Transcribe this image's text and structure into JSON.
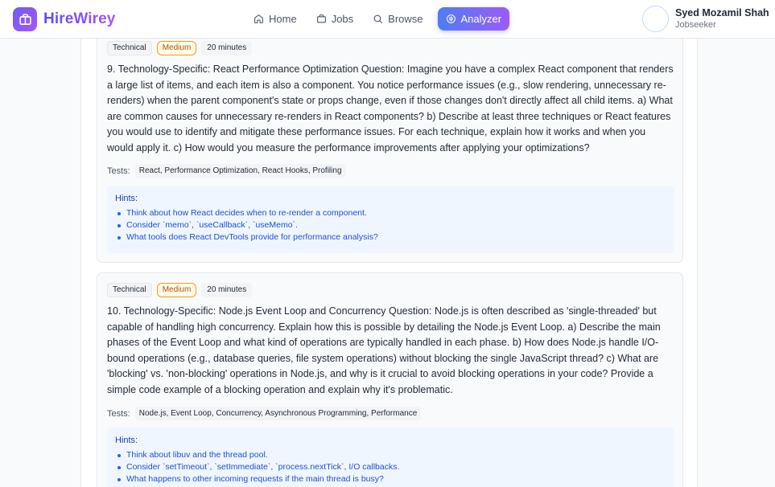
{
  "brand": {
    "name": "HireWirey"
  },
  "nav": {
    "items": [
      {
        "label": "Home",
        "icon": "home-icon"
      },
      {
        "label": "Jobs",
        "icon": "briefcase-icon"
      },
      {
        "label": "Browse",
        "icon": "search-icon"
      },
      {
        "label": "Analyzer",
        "icon": "analyzer-icon"
      }
    ],
    "active": "Analyzer"
  },
  "user": {
    "name": "Syed Mozamil Shah",
    "role": "Jobseeker"
  },
  "questions": [
    {
      "category": "Technical",
      "difficulty": "Medium",
      "duration": "20 minutes",
      "text": "9. Technology-Specific: React Performance Optimization Question: Imagine you have a complex React component that renders a large list of items, and each item is also a component. You notice performance issues (e.g., slow rendering, unnecessary re-renders) when the parent component's state or props change, even if those changes don't directly affect all child items. a) What are common causes for unnecessary re-renders in React components? b) Describe at least three techniques or React features you would use to identify and mitigate these performance issues. For each technique, explain how it works and when you would apply it. c) How would you measure the performance improvements after applying your optimizations?",
      "tests_label": "Tests:",
      "tests": "React, Performance Optimization, React Hooks, Profiling",
      "hints_title": "Hints:",
      "hints": [
        "Think about how React decides when to re-render a component.",
        "Consider `memo`, `useCallback`, `useMemo`.",
        "What tools does React DevTools provide for performance analysis?"
      ]
    },
    {
      "category": "Technical",
      "difficulty": "Medium",
      "duration": "20 minutes",
      "text": "10. Technology-Specific: Node.js Event Loop and Concurrency Question: Node.js is often described as 'single-threaded' but capable of handling high concurrency. Explain how this is possible by detailing the Node.js Event Loop. a) Describe the main phases of the Event Loop and what kind of operations are typically handled in each phase. b) How does Node.js handle I/O-bound operations (e.g., database queries, file system operations) without blocking the single JavaScript thread? c) What are 'blocking' vs. 'non-blocking' operations in Node.js, and why is it crucial to avoid blocking operations in your code? Provide a simple code example of a blocking operation and explain why it's problematic.",
      "tests_label": "Tests:",
      "tests": "Node.js, Event Loop, Concurrency, Asynchronous Programming, Performance",
      "hints_title": "Hints:",
      "hints": [
        "Think about libuv and the thread pool.",
        "Consider `setTimeout`, `setImmediate`, `process.nextTick`, I/O callbacks.",
        "What happens to other incoming requests if the main thread is busy?"
      ]
    }
  ]
}
